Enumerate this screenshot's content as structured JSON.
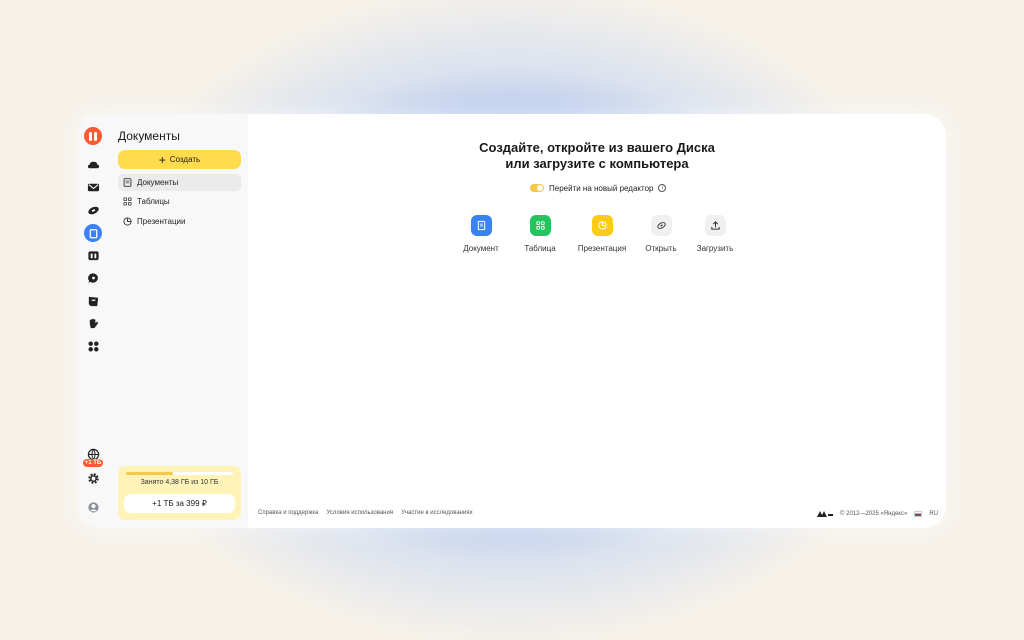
{
  "sidebar": {
    "title": "Документы",
    "create_label": "Создать",
    "items": [
      {
        "label": "Документы",
        "icon": "document-icon",
        "active": true
      },
      {
        "label": "Таблицы",
        "icon": "table-icon",
        "active": false
      },
      {
        "label": "Презентации",
        "icon": "presentation-icon",
        "active": false
      }
    ],
    "storage": {
      "used_text": "Занято 4,38 ГБ из 10 ГБ",
      "used_fraction": 0.438,
      "buy_label": "+1 ТБ за 399 ₽"
    }
  },
  "rail": {
    "badge": "+1 ТБ",
    "icons": [
      "yandex-logo-icon",
      "cloud-icon",
      "mail-icon",
      "disk-icon",
      "documents-icon",
      "calendar-icon",
      "messenger-icon",
      "notes-icon",
      "hand-icon",
      "apps-icon",
      "globe-icon",
      "settings-icon",
      "avatar-icon"
    ]
  },
  "main": {
    "headline_line1": "Создайте, откройте из вашего Диска",
    "headline_line2": "или загрузите с компьютера",
    "toggle_label": "Перейти на новый редактор",
    "toggle_on": true,
    "actions": [
      {
        "label": "Документ",
        "icon": "document-icon",
        "color": "#3b82f6"
      },
      {
        "label": "Таблица",
        "icon": "table-icon",
        "color": "#22c55e"
      },
      {
        "label": "Презентация",
        "icon": "presentation-icon",
        "color": "#facc15"
      },
      {
        "label": "Открыть",
        "icon": "open-icon",
        "color": "#f0f0f0"
      },
      {
        "label": "Загрузить",
        "icon": "upload-icon",
        "color": "#f0f0f0"
      }
    ]
  },
  "footer": {
    "links": [
      "Справка и поддержка",
      "Условия использования",
      "Участие в исследованиях"
    ],
    "copyright": "© 2012—2025 «Яндекс»",
    "lang": "RU"
  }
}
